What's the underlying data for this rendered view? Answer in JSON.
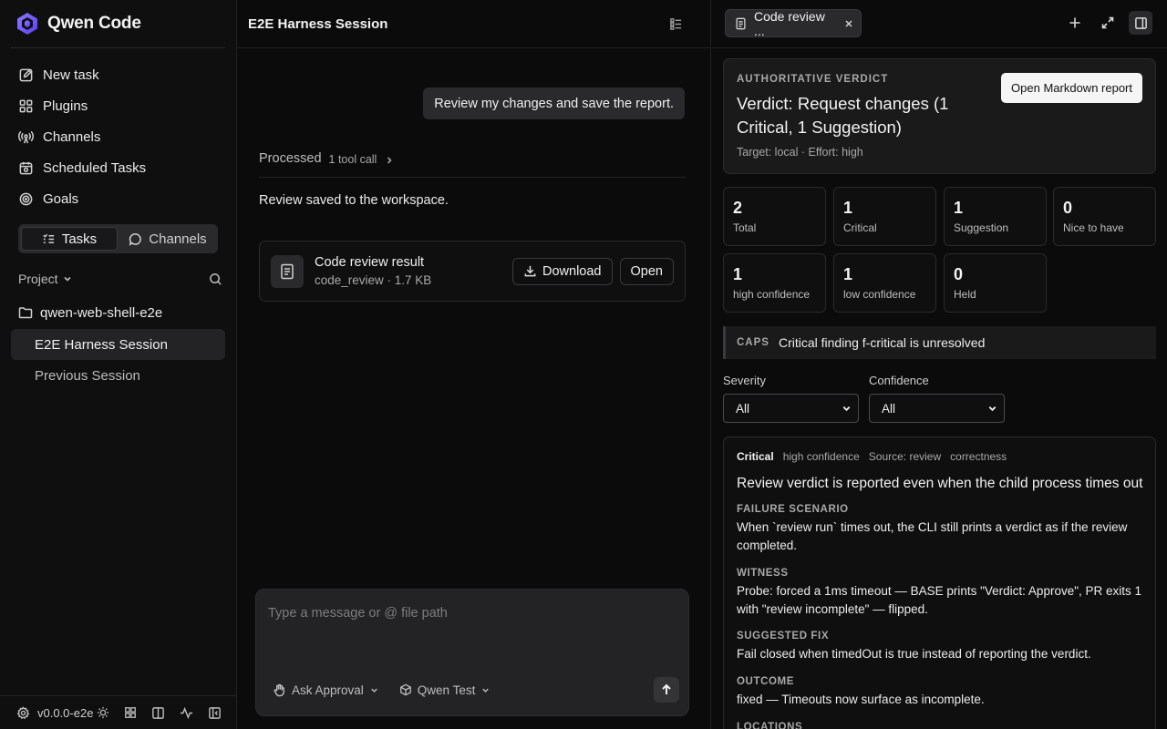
{
  "app": {
    "name": "Qwen Code",
    "version": "v0.0.0-e2e"
  },
  "sidebar": {
    "nav": [
      {
        "label": "New task",
        "icon": "edit-icon"
      },
      {
        "label": "Plugins",
        "icon": "plugins-icon"
      },
      {
        "label": "Channels",
        "icon": "broadcast-icon"
      },
      {
        "label": "Scheduled Tasks",
        "icon": "calendar-icon"
      },
      {
        "label": "Goals",
        "icon": "target-icon"
      }
    ],
    "segments": {
      "tasks": "Tasks",
      "channels": "Channels",
      "active": "tasks"
    },
    "project_label": "Project",
    "folder": "qwen-web-shell-e2e",
    "sessions": [
      {
        "label": "E2E Harness Session",
        "active": true
      },
      {
        "label": "Previous Session",
        "active": false
      }
    ]
  },
  "chat": {
    "title": "E2E Harness Session",
    "user_message": "Review my changes and save the report.",
    "processed_label": "Processed",
    "tool_call_count": "1 tool call",
    "assistant_text": "Review saved to the workspace.",
    "file": {
      "name": "Code review result",
      "meta": "code_review · 1.7 KB",
      "download": "Download",
      "open": "Open"
    },
    "composer": {
      "placeholder": "Type a message or @ file path",
      "approval": "Ask Approval",
      "model": "Qwen Test"
    }
  },
  "panel": {
    "tab_label": "Code review ...",
    "verdict": {
      "eyebrow": "AUTHORITATIVE VERDICT",
      "title": "Verdict: Request changes (1 Critical, 1 Suggestion)",
      "subtitle": "Target: local · Effort: high",
      "open_report": "Open Markdown report"
    },
    "stats": [
      {
        "value": "2",
        "label": "Total"
      },
      {
        "value": "1",
        "label": "Critical"
      },
      {
        "value": "1",
        "label": "Suggestion"
      },
      {
        "value": "0",
        "label": "Nice to have"
      },
      {
        "value": "1",
        "label": "high confidence"
      },
      {
        "value": "1",
        "label": "low confidence"
      },
      {
        "value": "0",
        "label": "Held"
      }
    ],
    "caps": {
      "tag": "CAPS",
      "text": "Critical finding f-critical is unresolved"
    },
    "filters": {
      "severity": {
        "label": "Severity",
        "value": "All"
      },
      "confidence": {
        "label": "Confidence",
        "value": "All"
      }
    },
    "finding": {
      "severity": "Critical",
      "confidence": "high confidence",
      "source": "Source: review",
      "category": "correctness",
      "title": "Review verdict is reported even when the child process times out",
      "sections": [
        {
          "heading": "FAILURE SCENARIO",
          "body": "When `review run` times out, the CLI still prints a verdict as if the review completed."
        },
        {
          "heading": "WITNESS",
          "body": "Probe: forced a 1ms timeout — BASE prints \"Verdict: Approve\", PR exits 1 with \"review incomplete\" — flipped."
        },
        {
          "heading": "SUGGESTED FIX",
          "body": "Fail closed when timedOut is true instead of reporting the verdict."
        },
        {
          "heading": "OUTCOME",
          "body": "fixed — Timeouts now surface as incomplete."
        },
        {
          "heading": "LOCATIONS",
          "body": ""
        }
      ]
    }
  }
}
